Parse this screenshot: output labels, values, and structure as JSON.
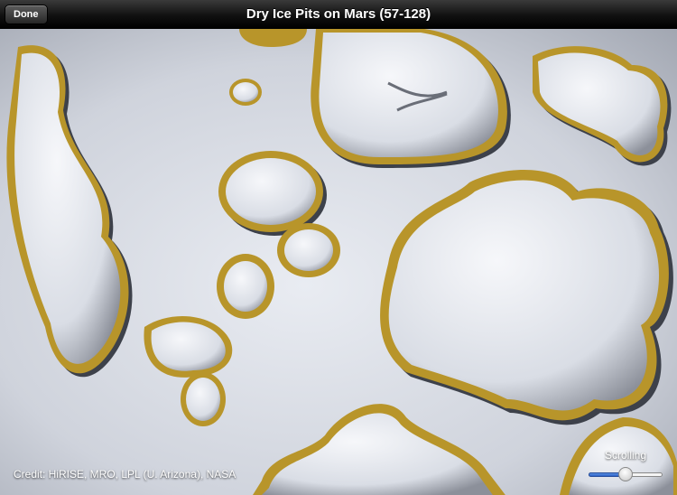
{
  "navbar": {
    "done_label": "Done",
    "title": "Dry Ice Pits on Mars  (57-128)"
  },
  "photo": {
    "description_icon": "mars-surface-photo"
  },
  "overlay": {
    "credit": "Credit:  HiRISE, MRO, LPL (U. Arizona), NASA",
    "scroll_label": "Scrolling",
    "scroll_value": 0.5
  },
  "colors": {
    "ice": "#e6e9ef",
    "rim_gold": "#b8952a",
    "shadow": "#4a4e58"
  }
}
